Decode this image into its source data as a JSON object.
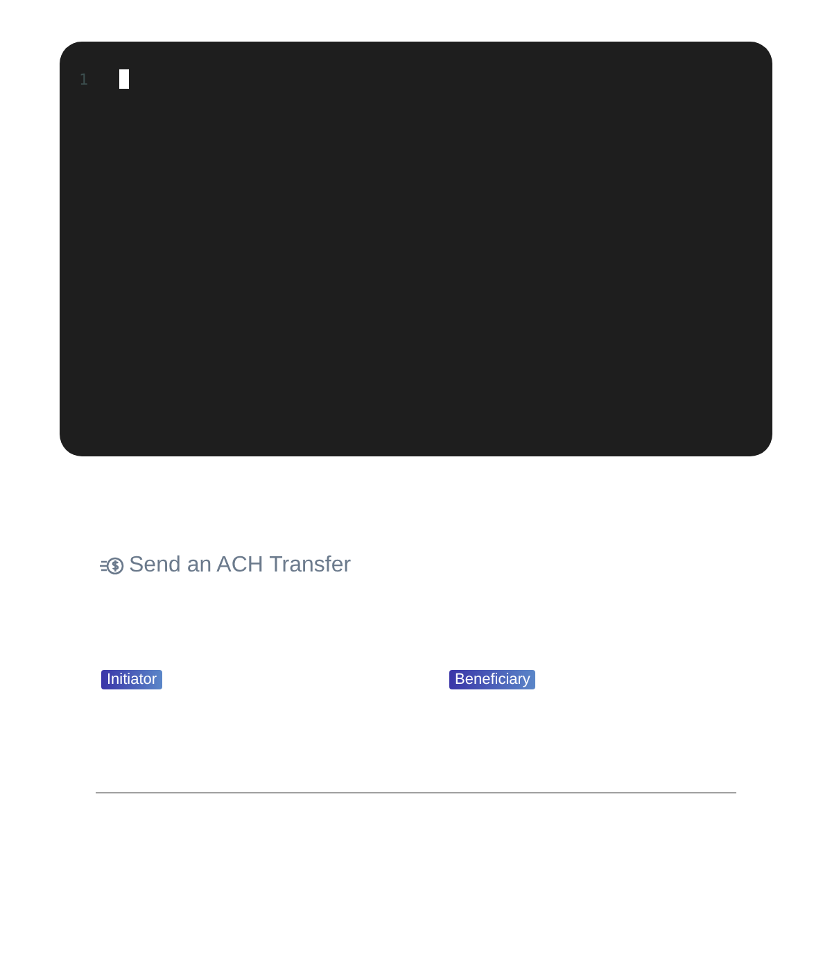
{
  "editor": {
    "line_numbers": [
      "1"
    ],
    "cursor": true
  },
  "transfer": {
    "title": "Send an ACH Transfer",
    "parties": [
      {
        "label": "Initiator"
      },
      {
        "label": "Beneficiary"
      }
    ]
  }
}
